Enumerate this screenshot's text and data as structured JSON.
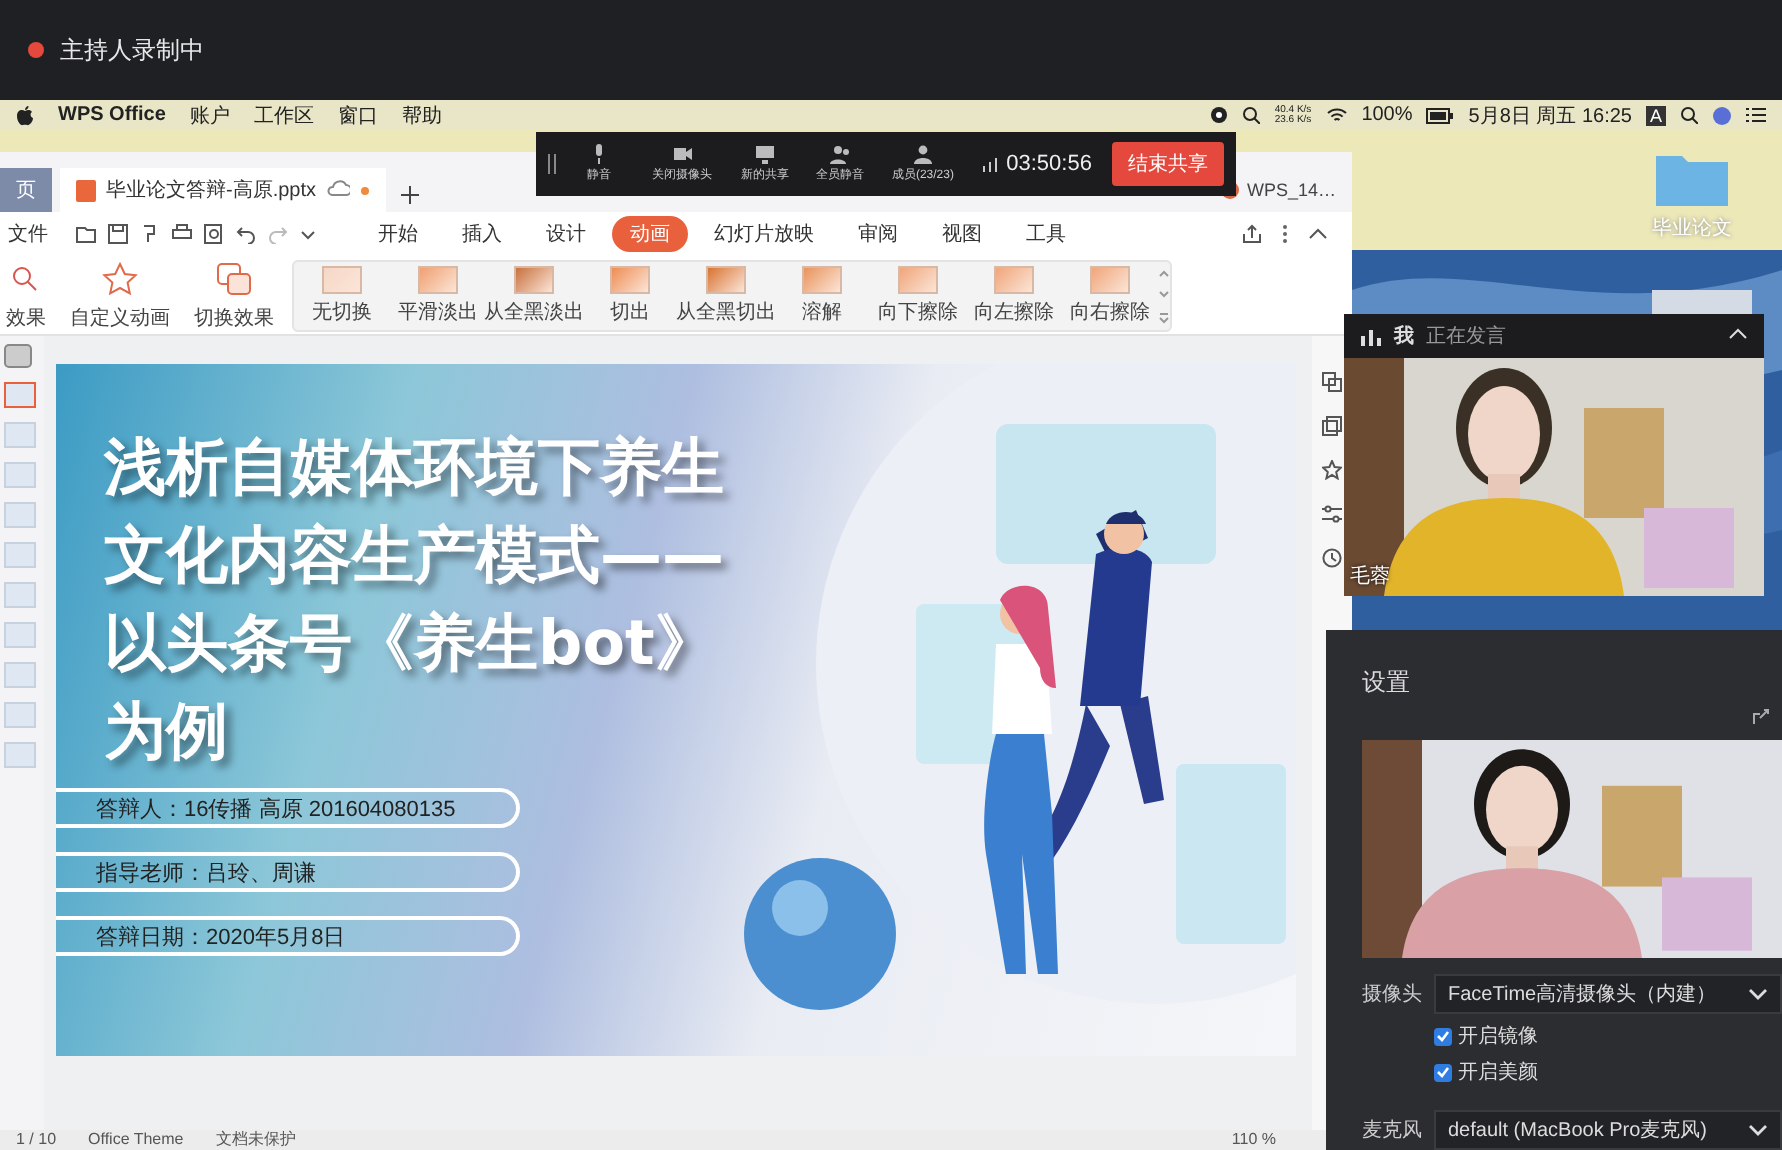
{
  "recording_banner": {
    "text": "主持人录制中"
  },
  "menu_bar": {
    "app": "WPS Office",
    "items": [
      "账户",
      "工作区",
      "窗口",
      "帮助"
    ],
    "net_up": "40.4 K/s",
    "net_down": "23.6 K/s",
    "battery": "100%",
    "datetime": "5月8日 周五 16:25",
    "input_source": "A"
  },
  "desktop": {
    "folder_label": "毕业论文"
  },
  "meeting_toolbar": {
    "buttons": [
      {
        "label": "静音",
        "kind": "mic"
      },
      {
        "label": "关闭摄像头",
        "kind": "camera"
      },
      {
        "label": "新的共享",
        "kind": "share"
      },
      {
        "label": "全员静音",
        "kind": "mute_all"
      },
      {
        "label": "成员(23/23)",
        "kind": "members"
      }
    ],
    "timer": "03:50:56",
    "end_button": "结束共享"
  },
  "wps": {
    "tabs": [
      {
        "label": "页",
        "kind": "home",
        "selected": false
      },
      {
        "label": "毕业论文答辩-高原.pptx",
        "kind": "doc",
        "selected": true
      }
    ],
    "other_window": "WPS_14…",
    "file_menu": "文件",
    "menu": [
      {
        "label": "开始",
        "selected": false
      },
      {
        "label": "插入",
        "selected": false
      },
      {
        "label": "设计",
        "selected": false
      },
      {
        "label": "动画",
        "selected": true
      },
      {
        "label": "幻灯片放映",
        "selected": false
      },
      {
        "label": "审阅",
        "selected": false
      },
      {
        "label": "视图",
        "selected": false
      },
      {
        "label": "工具",
        "selected": false
      }
    ],
    "ribbon": [
      {
        "label": "效果",
        "kind": "effect"
      },
      {
        "label": "自定义动画",
        "kind": "custom"
      },
      {
        "label": "切换效果",
        "kind": "switch"
      },
      {
        "label": "无切换",
        "kind": "none"
      },
      {
        "label": "平滑淡出",
        "kind": "fade"
      },
      {
        "label": "从全黑淡出",
        "kind": "black_fade"
      },
      {
        "label": "切出",
        "kind": "cut"
      },
      {
        "label": "从全黑切出",
        "kind": "black_cut"
      },
      {
        "label": "溶解",
        "kind": "dissolve"
      },
      {
        "label": "向下擦除",
        "kind": "down"
      },
      {
        "label": "向左擦除",
        "kind": "left"
      },
      {
        "label": "向右擦除",
        "kind": "right"
      }
    ],
    "slide": {
      "title_lines": [
        "浅析自媒体环境下养生",
        "文化内容生产模式——",
        "以头条号《养生bot》",
        "为例"
      ],
      "info": [
        "答辩人：16传播 高原 201604080135",
        "指导老师：吕玲、周谦",
        "答辩日期：2020年5月8日"
      ]
    },
    "status_bar": {
      "page": "1 / 10",
      "theme": "Office Theme",
      "protection": "文档未保护",
      "zoom": "110 %"
    }
  },
  "speaker_panel": {
    "me": "我",
    "status": "正在发言",
    "name": "毛蓉"
  },
  "settings": {
    "title": "设置",
    "camera_label": "摄像头",
    "camera": "FaceTime高清摄像头（内建）",
    "options": [
      {
        "label": "开启镜像",
        "checked": true
      },
      {
        "label": "开启美颜",
        "checked": true
      }
    ],
    "mic_label": "麦克风",
    "mic": "default (MacBook Pro麦克风)"
  }
}
